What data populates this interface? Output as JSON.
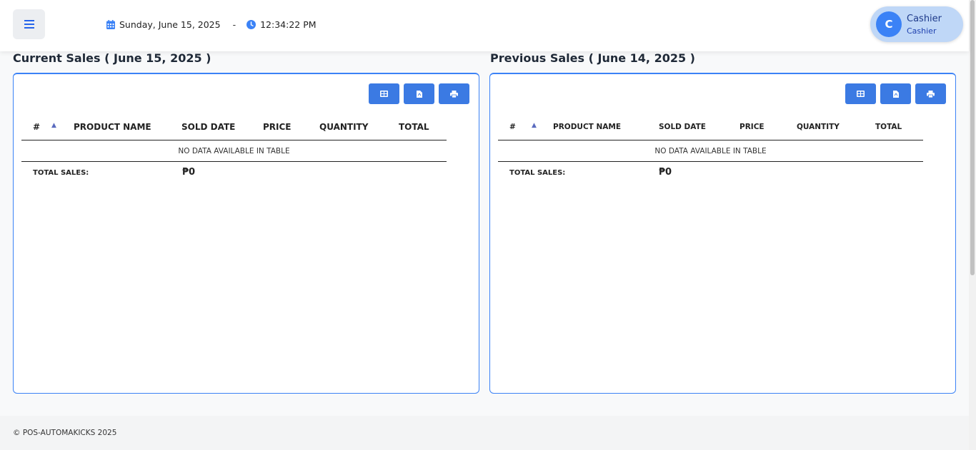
{
  "header": {
    "date": "Sunday, June 15, 2025",
    "separator": "-",
    "time": "12:34:22 PM",
    "user": {
      "initial": "C",
      "name": "Cashier",
      "role": "Cashier"
    },
    "icons": [
      "menu-icon",
      "calendar-icon",
      "clock-icon"
    ]
  },
  "current": {
    "title": "Current Sales ( June 15, 2025 )",
    "columns": [
      "#",
      "PRODUCT NAME",
      "SOLD DATE",
      "PRICE",
      "QUANTITY",
      "TOTAL"
    ],
    "empty_text": "NO DATA AVAILABLE IN TABLE",
    "total_label": "TOTAL SALES:",
    "total_value": "₱0"
  },
  "previous": {
    "title": "Previous Sales ( June 14, 2025 )",
    "columns": [
      "#",
      "PRODUCT NAME",
      "SOLD DATE",
      "PRICE",
      "QUANTITY",
      "TOTAL"
    ],
    "empty_text": "NO DATA AVAILABLE IN TABLE",
    "total_label": "TOTAL SALES:",
    "total_value": "₱0"
  },
  "export_buttons": [
    "excel-icon",
    "pdf-icon",
    "print-icon"
  ],
  "footer": {
    "text": "© POS-AUTOMAKICKS 2025"
  },
  "colors": {
    "accent": "#3b7ae3",
    "avatar": "#3b82f6",
    "chip": "#bfd7f7"
  }
}
